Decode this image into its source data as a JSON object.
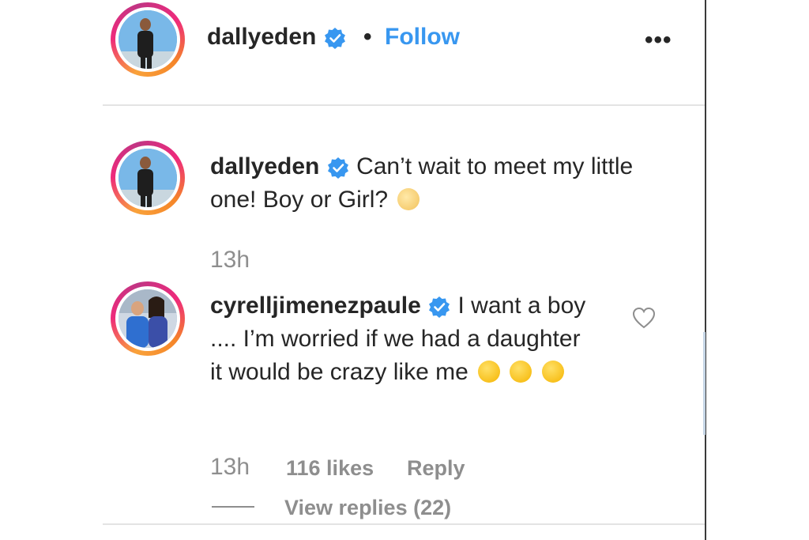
{
  "header": {
    "username": "dallyeden",
    "separator": "•",
    "follow_label": "Follow",
    "more_label": "•••"
  },
  "caption": {
    "username": "dallyeden",
    "text": "Can’t wait to meet my little one! Boy or Girl?",
    "emoji": "angel-baby-emoji",
    "time": "13h"
  },
  "comment": {
    "username": "cyrelljimenezpaule",
    "text": "I want a boy .... I’m worried if we had a daughter it would be crazy like me",
    "emojis": [
      "rofl-emoji",
      "joy-emoji",
      "rofl-emoji"
    ],
    "time": "13h",
    "likes": "116 likes",
    "reply_label": "Reply",
    "view_replies": "View replies (22)"
  },
  "colors": {
    "accent": "#3897f0",
    "verified": "#3897f0",
    "muted": "#8e8e8e",
    "text": "#262626"
  }
}
